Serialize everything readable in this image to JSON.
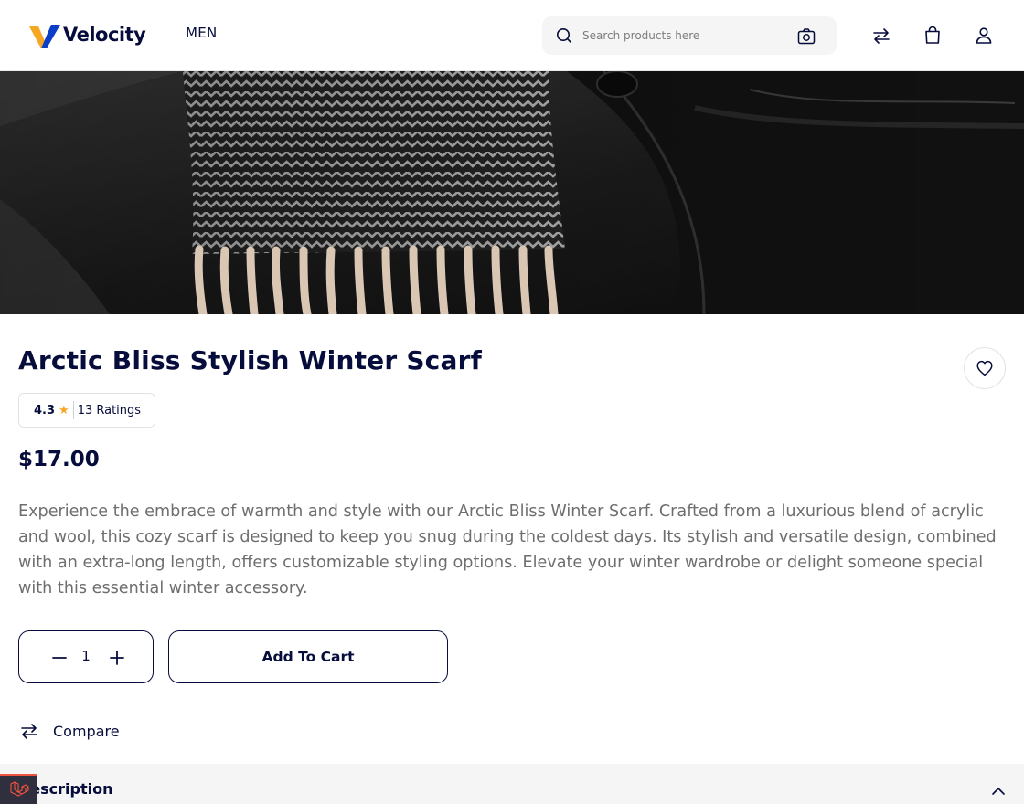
{
  "header": {
    "logo_text": "Velocity",
    "nav_item": "MEN",
    "search_placeholder": "Search products here"
  },
  "product": {
    "title": "Arctic Bliss Stylish Winter Scarf",
    "rating_value": "4.3",
    "ratings_count": "13 Ratings",
    "price": "$17.00",
    "description": "Experience the embrace of warmth and style with our Arctic Bliss Winter Scarf. Crafted from a luxurious blend of acrylic and wool, this cozy scarf is designed to keep you snug during the coldest days. Its stylish and versatile design, combined with an extra-long length, offers customizable styling options. Elevate your winter wardrobe or delight someone special with this essential winter accessory.",
    "quantity": "1",
    "add_to_cart_label": "Add To Cart",
    "compare_label": "Compare"
  },
  "sections": {
    "description_label": "Description"
  },
  "icons": {
    "search": "search-icon",
    "camera": "camera-icon",
    "compare": "compare-icon",
    "cart": "shopping-bag-icon",
    "account": "user-icon",
    "wishlist": "heart-icon",
    "star": "star-icon",
    "minus": "minus-icon",
    "plus": "plus-icon",
    "chevron": "chevron-up-icon",
    "badge": "laravel-icon"
  },
  "colors": {
    "primary": "#060c3b",
    "star": "#f5a623",
    "text_muted": "#6e6e6e",
    "logo_gold": "#f5a623",
    "logo_blue": "#0b3ec7"
  }
}
